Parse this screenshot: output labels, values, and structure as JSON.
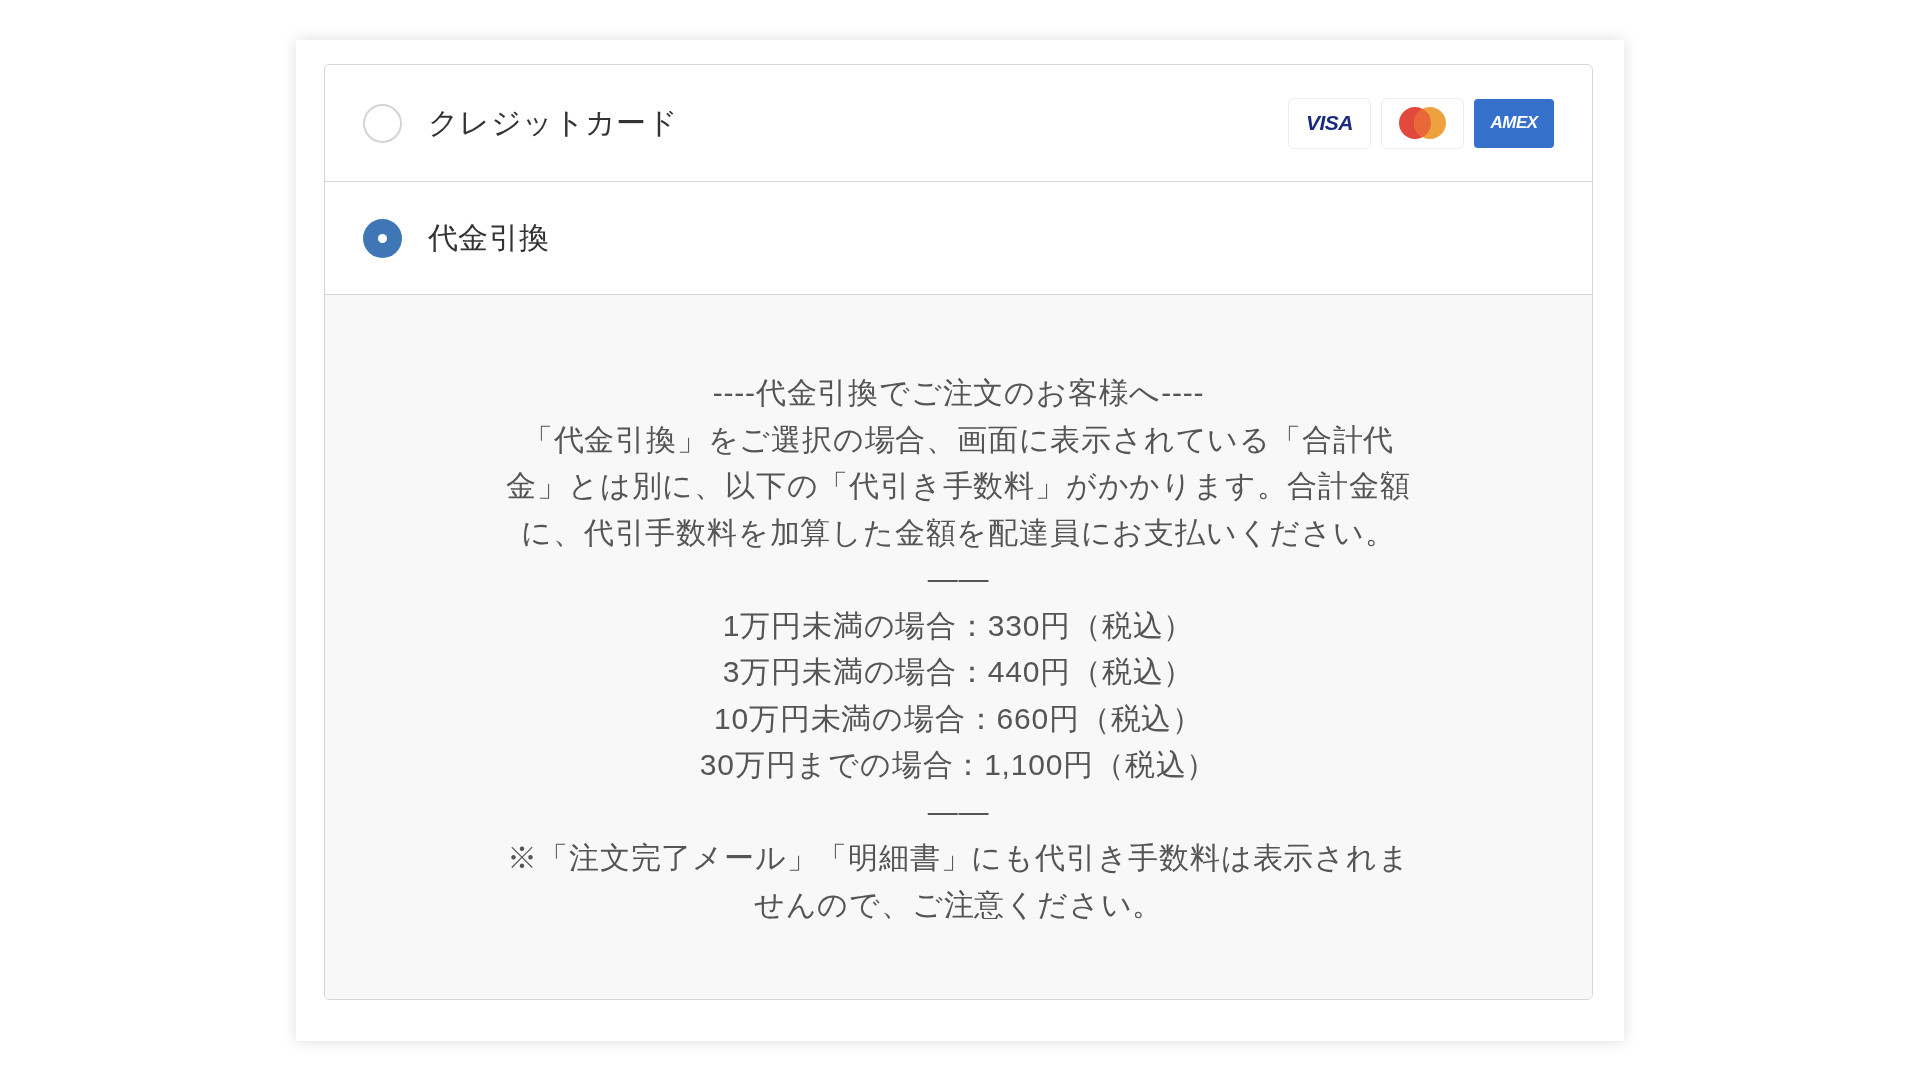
{
  "payment_methods": [
    {
      "label": "クレジットカード",
      "selected": false,
      "card_logos": [
        {
          "kind": "visa",
          "label": "VISA"
        },
        {
          "kind": "mastercard"
        },
        {
          "kind": "amex",
          "label": "AMEX"
        }
      ]
    },
    {
      "label": "代金引換",
      "selected": true,
      "details": [
        "----代金引換でご注文のお客様へ----",
        "「代金引換」をご選択の場合、画面に表示されている「合計代金」とは別に、以下の「代引き手数料」がかかります。合計金額に、代引手数料を加算した金額を配達員にお支払いください。",
        "——",
        "1万円未満の場合：330円（税込）",
        "3万円未満の場合：440円（税込）",
        "10万円未満の場合：660円（税込）",
        "30万円までの場合：1,100円（税込）",
        "——",
        "※「注文完了メール」「明細書」にも代引き手数料は表示されませんので、ご注意ください。"
      ]
    }
  ]
}
